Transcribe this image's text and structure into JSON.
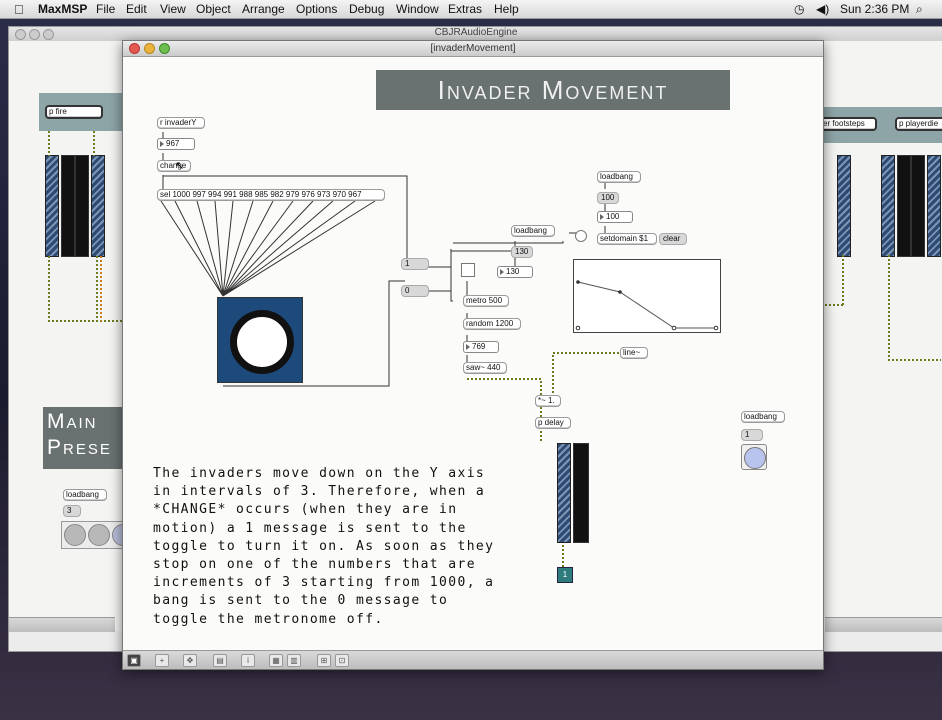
{
  "menubar": {
    "apple": "",
    "app": "MaxMSP",
    "items": [
      "File",
      "Edit",
      "View",
      "Object",
      "Arrange",
      "Options",
      "Debug",
      "Window",
      "Extras",
      "Help"
    ],
    "clock": "Sun 2:36 PM"
  },
  "back_window": {
    "title": "CBJRAudioEngine",
    "objects": {
      "p_fire": "p fire",
      "footsteps": "er footsteps",
      "playerdie": "p playerdie",
      "loadbang": "loadbang",
      "msg3": "3",
      "main_heading": "Main\nPrese"
    }
  },
  "front_window": {
    "title": "[invaderMovement]",
    "heading": "Invader Movement",
    "objects": {
      "r_invaderY": "r invaderY",
      "num967": "967",
      "change": "change",
      "sel": "sel 1000 997 994 991 988 985 982 979 976 973 970 967",
      "msg1": "1",
      "msg0": "0",
      "loadbang1": "loadbang",
      "msg130": "130",
      "num130": "130",
      "metro": "metro 500",
      "random": "random 1200",
      "num769": "769",
      "saw": "saw~ 440",
      "loadbang2": "loadbang",
      "msg100": "100",
      "num100": "100",
      "setdomain": "setdomain $1",
      "clear": "clear",
      "line": "line~",
      "mult": "*~ 1.",
      "pdelay": "p delay",
      "loadbang3": "loadbang",
      "msg1b": "1"
    },
    "comment": "The invaders move down on the Y axis in intervals of 3. Therefore, when a *CHANGE* occurs (when they are in motion) a 1 message is sent to the toggle to turn it on. As soon as they stop on one of the numbers that are increments of 3 starting from 1000, a bang is sent to the 0 message to toggle the metronome off.",
    "dac_label": "1"
  },
  "colors": {
    "heading_bg": "#6a7271",
    "toggle_panel": "#1d4a7a",
    "patchcord_audio": "#6e7a1e"
  }
}
